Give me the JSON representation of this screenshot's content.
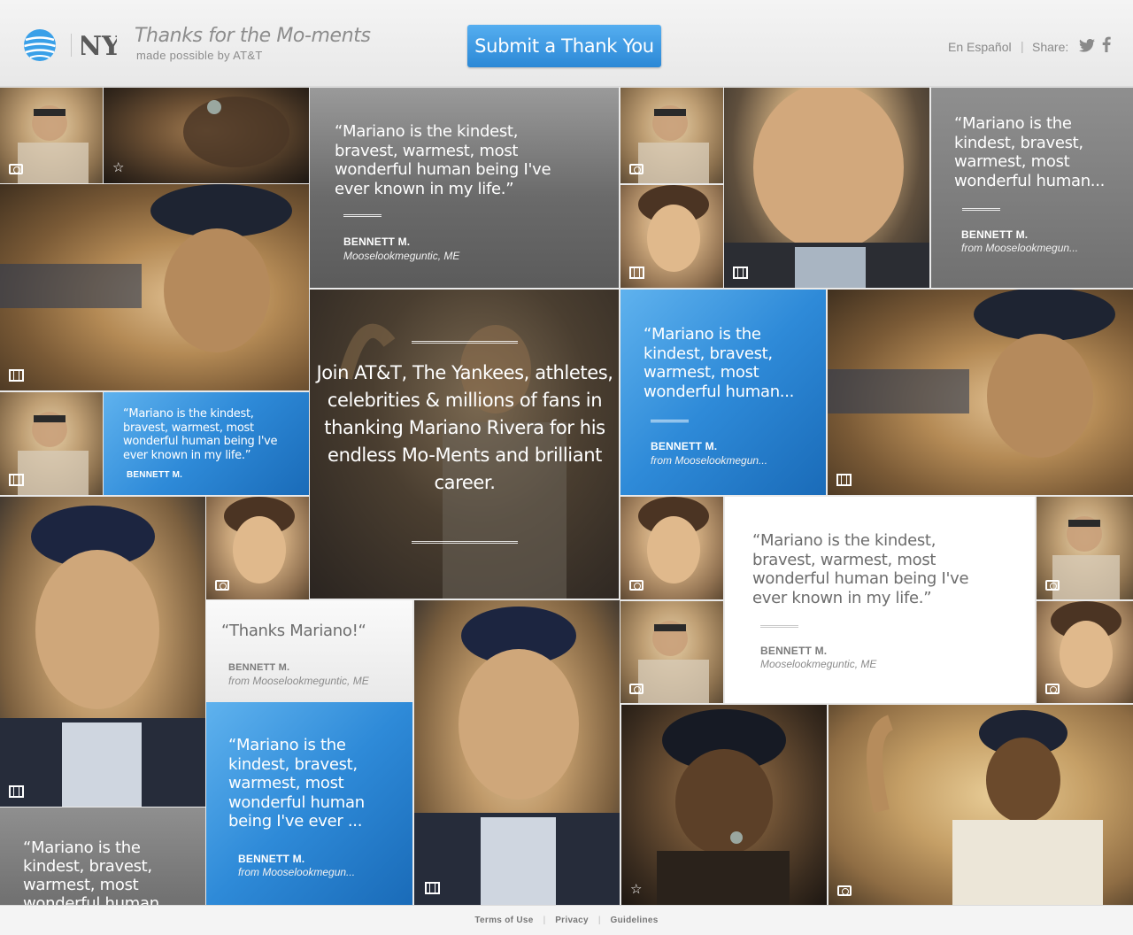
{
  "header": {
    "tagline": "Thanks for the Mo-ments",
    "subline": "made possible by AT&T",
    "submit_button": "Submit a Thank You",
    "language_link": "En Español",
    "separator": "|",
    "share_label": "Share:",
    "twitter_icon": "twitter-icon",
    "facebook_icon": "facebook-icon",
    "brand_blue": "#3c97de"
  },
  "promo": {
    "text": "Join AT&T, The Yankees, athletes, celebrities & millions of fans in thanking Mariano Rivera for his endless Mo-Ments and brilliant career."
  },
  "quotes": {
    "q1": {
      "text": "“Mariano is the kindest, bravest, warmest, most wonderful human being I've ever known in my life.”",
      "name": "BENNETT M.",
      "loc": "Mooselookmeguntic, ME"
    },
    "q2": {
      "text": "“Mariano is the kindest, bravest, warmest, most wonderful human...",
      "name": "BENNETT M.",
      "loc": "from Mooselookmegun..."
    },
    "q3": {
      "text": "“Mariano is the kindest, bravest, warmest, most wonderful human being I've ever known in my life.”",
      "name": "BENNETT M."
    },
    "q4": {
      "text": "“Mariano is the kindest, bravest, warmest, most wonderful human...",
      "name": "BENNETT M.",
      "loc": "from Mooselookmegun..."
    },
    "q5": {
      "text": "“Mariano is the kindest, bravest, warmest, most wonderful human being I've ever known in my life.”",
      "name": "BENNETT M.",
      "loc": "Mooselookmeguntic, ME"
    },
    "q6": {
      "text": "“Thanks Mariano!“",
      "name": "BENNETT M.",
      "loc": "from Mooselookmeguntic, ME"
    },
    "q7": {
      "text": "“Mariano is the kindest, bravest, warmest, most wonderful human being I've ever ...",
      "name": "BENNETT M.",
      "loc": "from Mooselookmegun..."
    },
    "q8": {
      "text": "“Mariano is the kindest, bravest, warmest, most wonderful human"
    }
  },
  "footer": {
    "terms": "Terms of Use",
    "privacy": "Privacy",
    "guidelines": "Guidelines",
    "sep": "|"
  }
}
